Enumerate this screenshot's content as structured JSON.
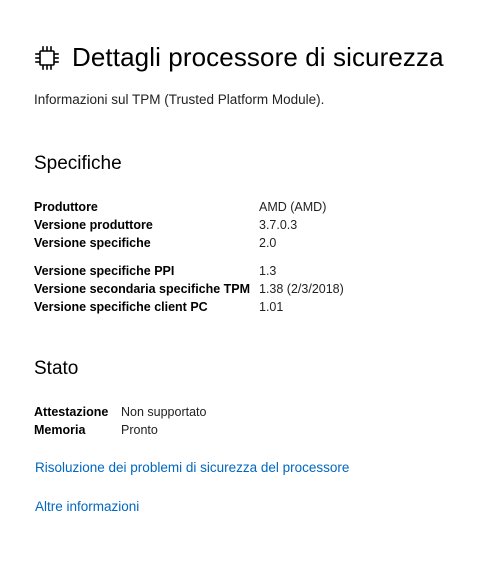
{
  "header": {
    "icon": "chip-icon",
    "title": "Dettagli processore di sicurezza",
    "subtitle": "Informazioni sul TPM (Trusted Platform Module)."
  },
  "specifiche": {
    "heading": "Specifiche",
    "group1": [
      {
        "label": "Produttore",
        "value": "AMD (AMD)"
      },
      {
        "label": "Versione produttore",
        "value": "3.7.0.3"
      },
      {
        "label": "Versione specifiche",
        "value": "2.0"
      }
    ],
    "group2": [
      {
        "label": "Versione specifiche PPI",
        "value": "1.3"
      },
      {
        "label": "Versione secondaria specifiche TPM",
        "value": "1.38 (2/3/2018)"
      },
      {
        "label": "Versione specifiche client PC",
        "value": "1.01"
      }
    ]
  },
  "stato": {
    "heading": "Stato",
    "rows": [
      {
        "label": "Attestazione",
        "value": "Non supportato"
      },
      {
        "label": "Memoria",
        "value": "Pronto"
      }
    ]
  },
  "links": {
    "troubleshoot": "Risoluzione dei problemi di sicurezza del processore",
    "more_info": "Altre informazioni"
  },
  "colors": {
    "link": "#0067c0",
    "text": "#000000",
    "background": "#ffffff"
  }
}
